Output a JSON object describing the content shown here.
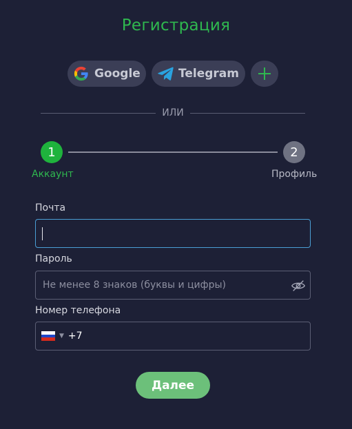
{
  "title": "Регистрация",
  "social": {
    "google_label": "Google",
    "telegram_label": "Telegram",
    "more_icon": "plus-icon"
  },
  "divider_text": "ИЛИ",
  "stepper": {
    "steps": [
      {
        "number": "1",
        "label": "Аккаунт",
        "state": "active"
      },
      {
        "number": "2",
        "label": "Профиль",
        "state": "inactive"
      }
    ]
  },
  "form": {
    "email": {
      "label": "Почта",
      "value": "",
      "placeholder": ""
    },
    "password": {
      "label": "Пароль",
      "value": "",
      "placeholder": "Не менее 8 знаков (буквы и цифры)"
    },
    "phone": {
      "label": "Номер телефона",
      "country": "RU",
      "code": "+7"
    }
  },
  "next_label": "Далее",
  "colors": {
    "background": "#1d2036",
    "accent": "#1fb33d",
    "button": "#6cc07a",
    "focus_border": "#4b9fd6"
  }
}
